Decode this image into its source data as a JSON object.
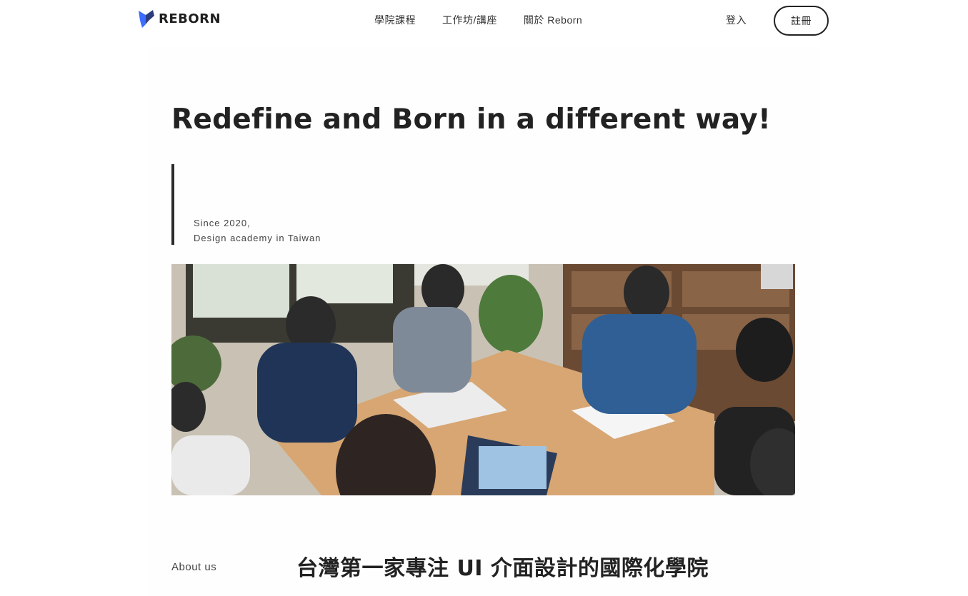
{
  "header": {
    "logo_text": "REBORN",
    "nav": [
      {
        "label": "學院課程"
      },
      {
        "label": "工作坊/講座"
      },
      {
        "label": "關於 Reborn"
      }
    ],
    "login_label": "登入",
    "signup_label": "註冊"
  },
  "hero": {
    "title": "Redefine and Born in a different way!",
    "since_line1": "Since 2020,",
    "since_line2": "Design academy in Taiwan"
  },
  "about": {
    "label": "About us",
    "heading": "台灣第一家專注 UI 介面設計的國際化學院"
  },
  "colors": {
    "brand_blue": "#3b6cff",
    "brand_dark": "#1f1f1f",
    "text": "#222222"
  }
}
